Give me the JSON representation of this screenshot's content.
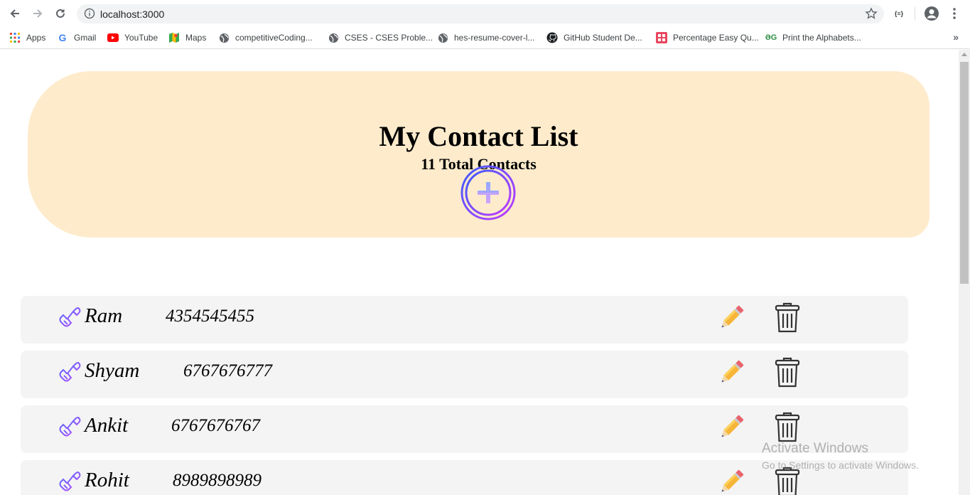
{
  "browser": {
    "url": "localhost:3000",
    "extension_label": "{≡}",
    "bookmarks": [
      {
        "label": "Apps",
        "icon": "apps-grid-icon"
      },
      {
        "label": "Gmail",
        "icon": "google-icon"
      },
      {
        "label": "YouTube",
        "icon": "youtube-icon"
      },
      {
        "label": "Maps",
        "icon": "maps-icon"
      },
      {
        "label": "competitiveCoding...",
        "icon": "globe-icon"
      },
      {
        "label": "CSES - CSES Proble...",
        "icon": "globe-icon"
      },
      {
        "label": "hes-resume-cover-l...",
        "icon": "globe-icon"
      },
      {
        "label": "GitHub Student De...",
        "icon": "github-icon"
      },
      {
        "label": "Percentage Easy Qu...",
        "icon": "grid-app-icon"
      },
      {
        "label": "Print the Alphabets...",
        "icon": "gfg-icon"
      }
    ],
    "more_label": "»"
  },
  "app": {
    "title": "My Contact List",
    "subtitle": "11 Total Contacts",
    "add_icon": "plus-circle-icon",
    "accent_gradient": [
      "#3b5bff",
      "#b23bff"
    ],
    "header_bg": "#feebcc"
  },
  "contacts": [
    {
      "name": "Ram",
      "phone": "4354545455"
    },
    {
      "name": "Shyam",
      "phone": "6767676777"
    },
    {
      "name": "Ankit",
      "phone": "6767676767"
    },
    {
      "name": "Rohit",
      "phone": "8989898989"
    }
  ],
  "watermark": {
    "line1": "Activate Windows",
    "line2": "Go to Settings to activate Windows."
  }
}
